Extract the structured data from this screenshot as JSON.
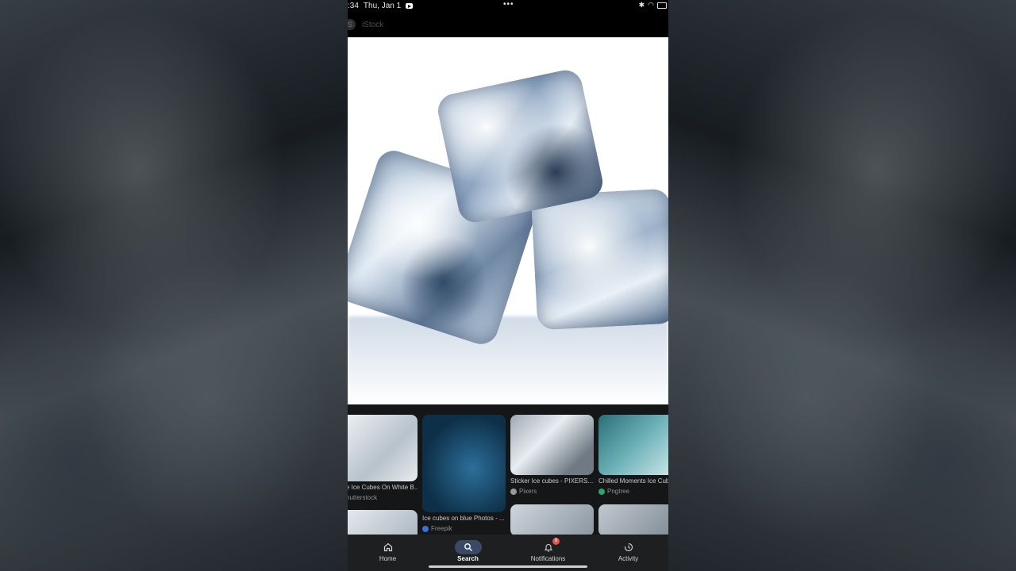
{
  "status_bar": {
    "time": ":34",
    "date": "Thu, Jan 1",
    "dots": "•••"
  },
  "header": {
    "source_initial": "S",
    "source_name": "iStock"
  },
  "main_image": {
    "icon": "ice-cubes-photo"
  },
  "related": [
    {
      "title": "e Ice Cubes On White B...",
      "source": "hutterstock",
      "source_color": "#6a7a8a"
    },
    {
      "title": "Ice cubes on blue Photos - ...",
      "source": "Freepik",
      "source_color": "#3b6fd8"
    },
    {
      "title": "Sticker Ice cubes - PIXERS....",
      "source": "Pixers",
      "source_color": "#9a9a9a"
    },
    {
      "title": "Chilled Moments Ice Cub...",
      "source": "Pngtree",
      "source_color": "#2fa36b"
    }
  ],
  "nav": {
    "home": "Home",
    "search": "Search",
    "notifications": "Notifications",
    "notifications_count": "9",
    "activity": "Activity"
  },
  "colors": {
    "accent": "#3a4a66",
    "badge": "#e2574c"
  }
}
